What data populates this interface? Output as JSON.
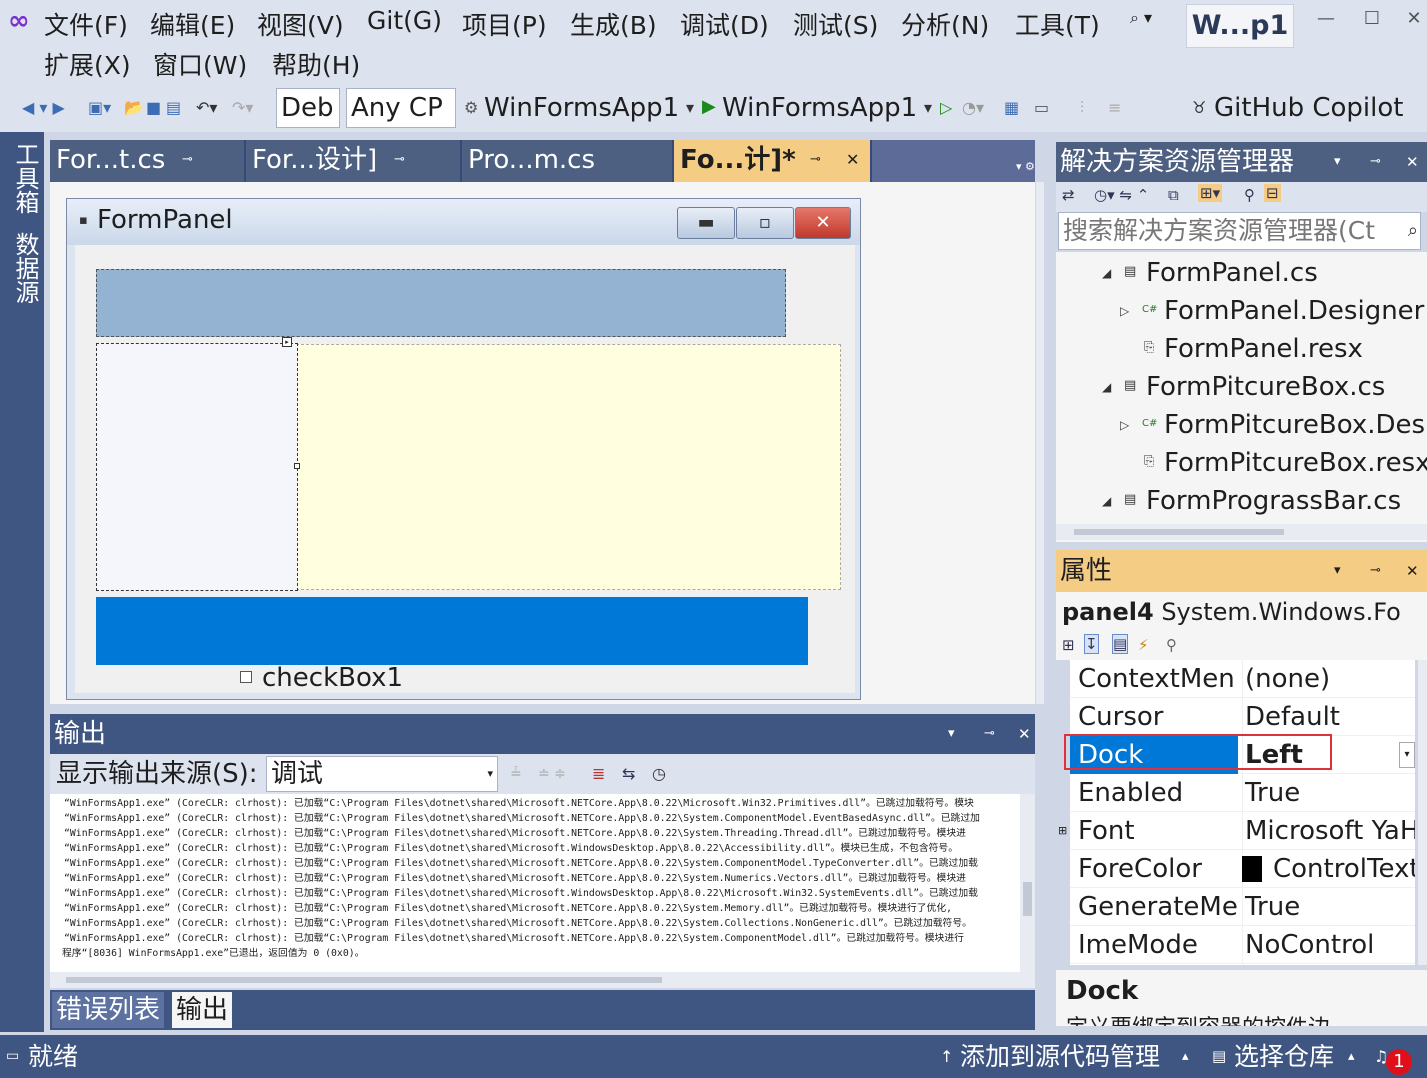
{
  "menu": {
    "items": [
      "文件(F)",
      "编辑(E)",
      "视图(V)",
      "Git(G)",
      "项目(P)",
      "生成(B)",
      "调试(D)",
      "测试(S)",
      "分析(N)",
      "工具(T)",
      "扩展(X)",
      "窗口(W)",
      "帮助(H)"
    ],
    "solution_badge": "W...p1"
  },
  "toolbar": {
    "config": "Deb",
    "platform": "Any CP",
    "startup_project": "WinFormsApp1",
    "run_target": "WinFormsApp1",
    "copilot": "GitHub Copilot"
  },
  "left_strip": {
    "toolbox": "工具箱",
    "datasource": "数据源"
  },
  "doc_tabs": [
    "For...t.cs",
    "For...设计]",
    "Pro...m.cs",
    "Fo...计]*"
  ],
  "form": {
    "title": "FormPanel",
    "checkbox_label": "checkBox1"
  },
  "output": {
    "title": "输出",
    "source_label": "显示输出来源(S):",
    "source_value": "调试",
    "lines": [
      "“WinFormsApp1.exe” (CoreCLR: clrhost): 已加载“C:\\Program Files\\dotnet\\shared\\Microsoft.NETCore.App\\8.0.22\\Microsoft.Win32.Primitives.dll”。已跳过加载符号。模块",
      "“WinFormsApp1.exe” (CoreCLR: clrhost): 已加载“C:\\Program Files\\dotnet\\shared\\Microsoft.NETCore.App\\8.0.22\\System.ComponentModel.EventBasedAsync.dll”。已跳过加",
      "“WinFormsApp1.exe” (CoreCLR: clrhost): 已加载“C:\\Program Files\\dotnet\\shared\\Microsoft.NETCore.App\\8.0.22\\System.Threading.Thread.dll”。已跳过加载符号。模块进",
      "“WinFormsApp1.exe” (CoreCLR: clrhost): 已加载“C:\\Program Files\\dotnet\\shared\\Microsoft.WindowsDesktop.App\\8.0.22\\Accessibility.dll”。模块已生成，不包含符号。",
      "“WinFormsApp1.exe” (CoreCLR: clrhost): 已加载“C:\\Program Files\\dotnet\\shared\\Microsoft.NETCore.App\\8.0.22\\System.ComponentModel.TypeConverter.dll”。已跳过加载",
      "“WinFormsApp1.exe” (CoreCLR: clrhost): 已加载“C:\\Program Files\\dotnet\\shared\\Microsoft.NETCore.App\\8.0.22\\System.Numerics.Vectors.dll”。已跳过加载符号。模块进",
      "“WinFormsApp1.exe” (CoreCLR: clrhost): 已加载“C:\\Program Files\\dotnet\\shared\\Microsoft.WindowsDesktop.App\\8.0.22\\Microsoft.Win32.SystemEvents.dll”。已跳过加载",
      "“WinFormsApp1.exe” (CoreCLR: clrhost): 已加载“C:\\Program Files\\dotnet\\shared\\Microsoft.NETCore.App\\8.0.22\\System.Memory.dll”。已跳过加载符号。模块进行了优化,",
      "“WinFormsApp1.exe” (CoreCLR: clrhost): 已加载“C:\\Program Files\\dotnet\\shared\\Microsoft.NETCore.App\\8.0.22\\System.Collections.NonGeneric.dll”。已跳过加载符号。",
      "“WinFormsApp1.exe” (CoreCLR: clrhost): 已加载“C:\\Program Files\\dotnet\\shared\\Microsoft.NETCore.App\\8.0.22\\System.ComponentModel.dll”。已跳过加载符号。模块进行",
      "程序“[8036] WinFormsApp1.exe”已退出，返回值为 0 (0x0)。"
    ]
  },
  "bottom_tabs": [
    "错误列表",
    "输出"
  ],
  "solution_explorer": {
    "title": "解决方案资源管理器",
    "search_placeholder": "搜索解决方案资源管理器(Ct",
    "items": [
      "FormPanel.cs",
      "FormPanel.Designer",
      "FormPanel.resx",
      "FormPitcureBox.cs",
      "FormPitcureBox.Des",
      "FormPitcureBox.resx",
      "FormPrograssBar.cs"
    ]
  },
  "properties": {
    "title": "属性",
    "object_name": "panel4",
    "object_type": "System.Windows.Fo",
    "rows": [
      {
        "name": "ContextMen",
        "value": "(none)"
      },
      {
        "name": "Cursor",
        "value": "Default"
      },
      {
        "name": "Dock",
        "value": "Left"
      },
      {
        "name": "Enabled",
        "value": "True"
      },
      {
        "name": "Font",
        "value": "Microsoft YaH"
      },
      {
        "name": "ForeColor",
        "value": "ControlText"
      },
      {
        "name": "GenerateMe",
        "value": "True"
      },
      {
        "name": "ImeMode",
        "value": "NoControl"
      }
    ],
    "description_title": "Dock",
    "description_text": "定义要绑定到容器的控件边"
  },
  "status": {
    "ready": "就绪",
    "add_source": "添加到源代码管理",
    "select_repo": "选择仓库",
    "notifications": "1"
  },
  "colors": {
    "accent_blue": "#0078d7",
    "selection": "#0078d7",
    "tab_active": "#f5cc84",
    "panel_header": "#3f5683"
  }
}
